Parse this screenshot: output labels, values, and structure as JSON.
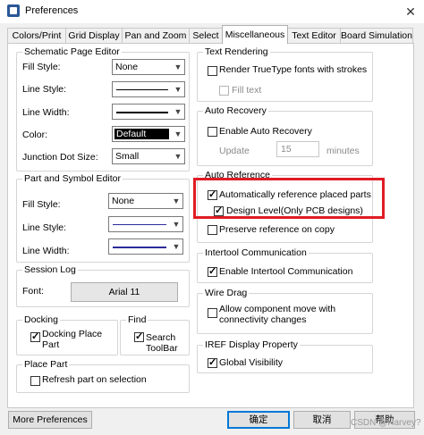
{
  "window": {
    "title": "Preferences",
    "close_glyph": "✕"
  },
  "tabs": [
    "Colors/Print",
    "Grid Display",
    "Pan and Zoom",
    "Select",
    "Miscellaneous",
    "Text Editor",
    "Board Simulation"
  ],
  "active_tab": "Miscellaneous",
  "schematic_page_editor": {
    "legend": "Schematic Page Editor",
    "fill_style_label": "Fill Style:",
    "fill_style_value": "None",
    "line_style_label": "Line Style:",
    "line_width_label": "Line Width:",
    "color_label": "Color:",
    "color_value": "Default",
    "junction_label": "Junction Dot Size:",
    "junction_value": "Small"
  },
  "part_symbol_editor": {
    "legend": "Part and Symbol Editor",
    "fill_style_label": "Fill Style:",
    "fill_style_value": "None",
    "line_style_label": "Line Style:",
    "line_width_label": "Line Width:"
  },
  "session_log": {
    "legend": "Session Log",
    "font_label": "Font:",
    "font_value": "Arial 11"
  },
  "docking": {
    "legend": "Docking",
    "option": "Docking Place Part",
    "checked": true
  },
  "find": {
    "legend": "Find",
    "option": "Search ToolBar",
    "checked": true
  },
  "place_part": {
    "legend": "Place Part",
    "option": "Refresh part on selection",
    "checked": false
  },
  "text_rendering": {
    "legend": "Text Rendering",
    "render_truetype": "Render TrueType fonts with strokes",
    "render_checked": false,
    "fill_text": "Fill text",
    "fill_checked": false
  },
  "auto_recovery": {
    "legend": "Auto Recovery",
    "enable": "Enable Auto Recovery",
    "enable_checked": false,
    "update_label": "Update",
    "update_value": "15",
    "minutes_label": "minutes"
  },
  "auto_reference": {
    "legend": "Auto Reference",
    "auto_ref": "Automatically reference placed parts",
    "auto_ref_checked": true,
    "design_level": "Design Level(Only PCB designs)",
    "design_level_checked": true,
    "preserve": "Preserve reference on copy",
    "preserve_checked": false
  },
  "intertool": {
    "legend": "Intertool Communication",
    "enable": "Enable Intertool Communication",
    "checked": true
  },
  "wire_drag": {
    "legend": "Wire Drag",
    "allow": "Allow component move with connectivity changes",
    "checked": false
  },
  "iref": {
    "legend": "IREF Display Property",
    "global": "Global Visibility",
    "checked": true
  },
  "buttons": {
    "more": "More Preferences",
    "ok": "确定",
    "cancel": "取消",
    "help": "帮助"
  },
  "watermark": "CSDN @Harvey?"
}
